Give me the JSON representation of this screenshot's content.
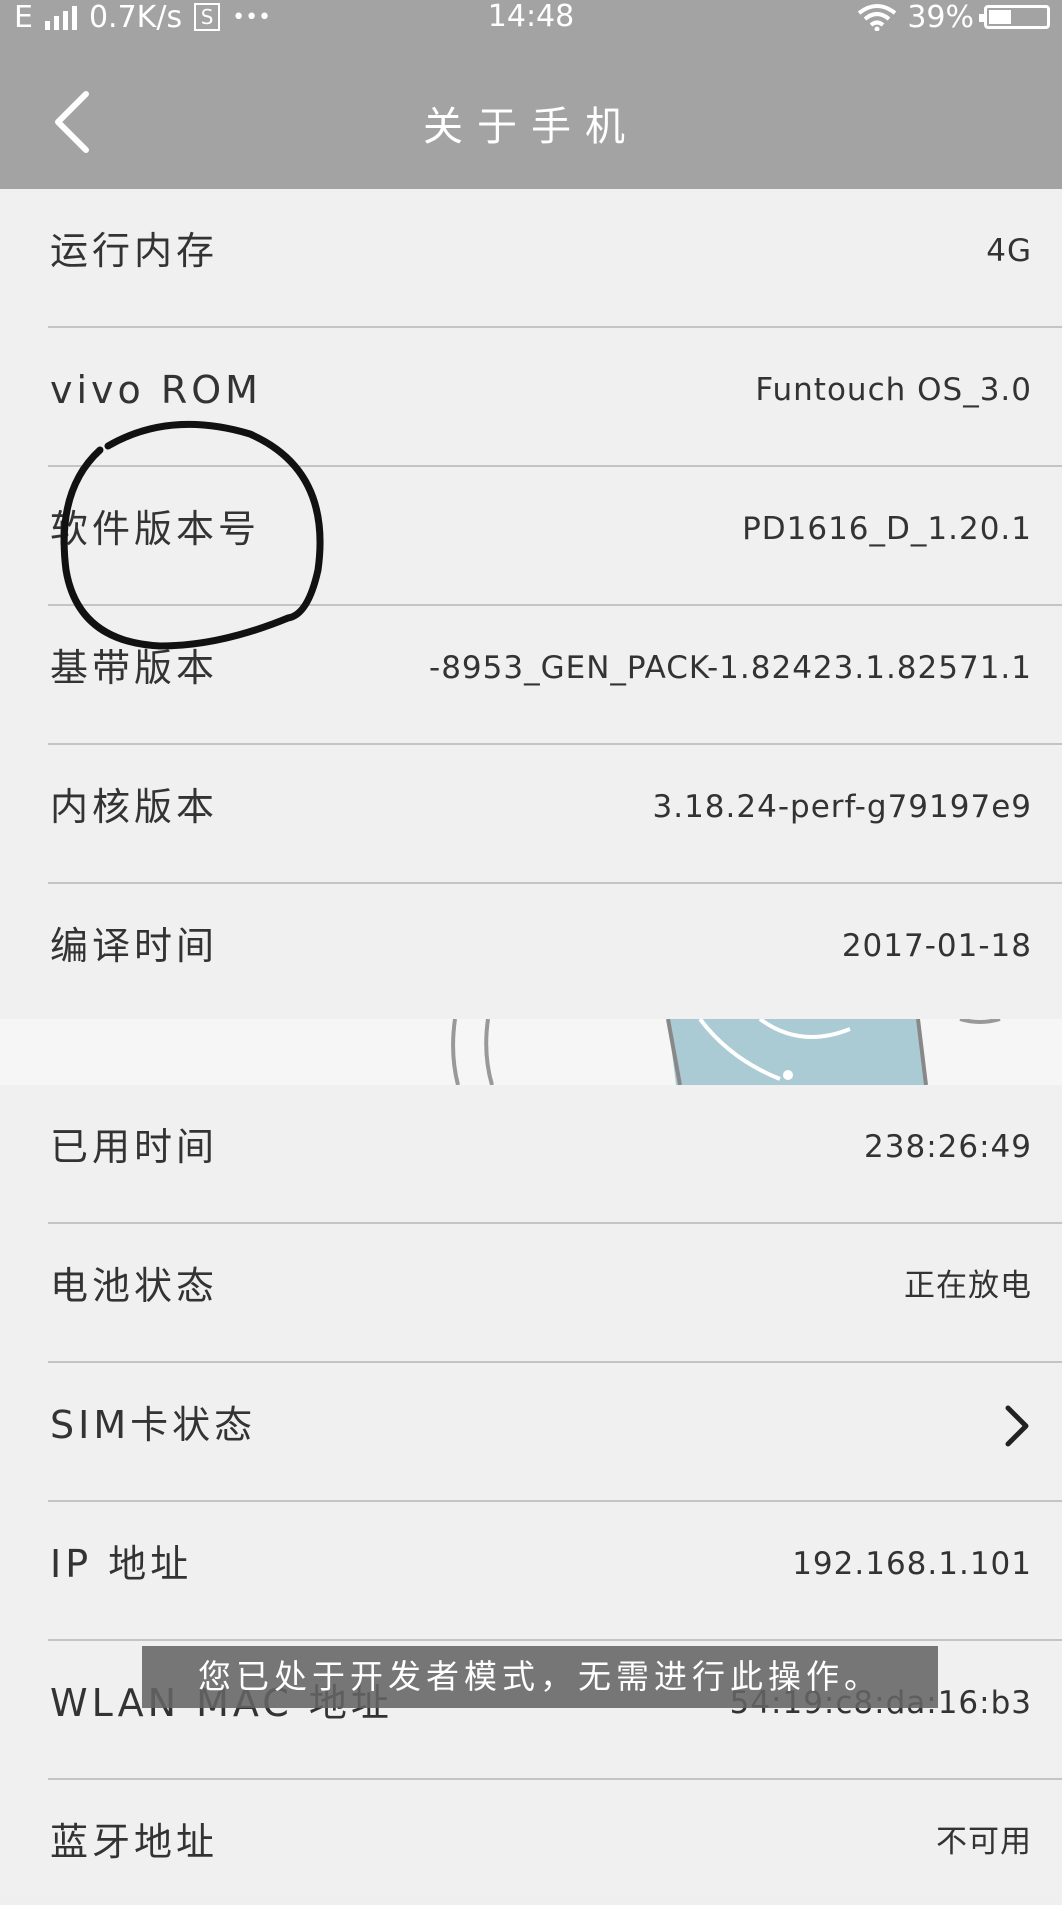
{
  "status_bar": {
    "network": "E",
    "speed": "0.7K/s",
    "sim_icon": "S",
    "dots": "•••",
    "time": "14:48",
    "battery": "39%",
    "battery_fraction": 0.39
  },
  "header": {
    "title": "关于手机",
    "back_icon": "chevron-left-icon"
  },
  "info_rows": [
    {
      "label": "运行内存",
      "value": "4G"
    },
    {
      "label": "vivo ROM",
      "value": "Funtouch OS_3.0"
    },
    {
      "label": "软件版本号",
      "value": "PD1616_D_1.20.1"
    },
    {
      "label": "基带版本",
      "value": "-8953_GEN_PACK-1.82423.1.82571.1"
    },
    {
      "label": "内核版本",
      "value": "3.18.24-perf-g79197e9"
    },
    {
      "label": "编译时间",
      "value": "2017-01-18"
    }
  ],
  "status_rows": [
    {
      "label": "已用时间",
      "value": "238:26:49"
    },
    {
      "label": "电池状态",
      "value": "正在放电"
    },
    {
      "label": "SIM卡状态",
      "value": ""
    },
    {
      "label": "IP 地址",
      "value": "192.168.1.101"
    },
    {
      "label": "WLAN MAC 地址",
      "value": "54:19:c8:da:16:b3"
    },
    {
      "label": "蓝牙地址",
      "value": "不可用"
    }
  ],
  "toast": "您已处于开发者模式，无需进行此操作。",
  "colors": {
    "header_bg": "#a3a3a3",
    "page_bg": "#efefef",
    "divider": "#c4c4c4",
    "annotation": "#111111"
  }
}
